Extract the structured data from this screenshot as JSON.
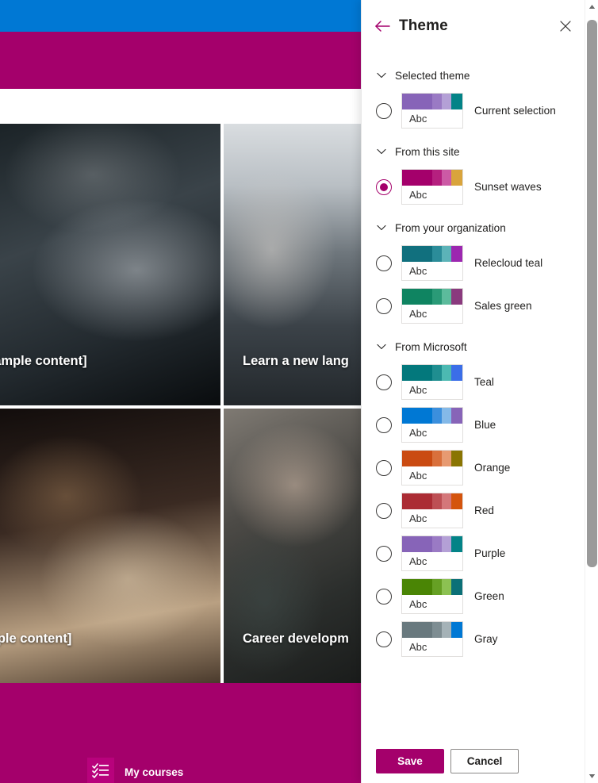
{
  "background": {
    "nav_bar_color": "#0078d4",
    "hero_band_color": "#a4006b",
    "footer_color": "#a4006b",
    "cards": [
      {
        "title": "s [Sample content]",
        "image": "handshake-photo"
      },
      {
        "title": "Learn a new lang",
        "image": "office-meeting-photo"
      },
      {
        "title": "Sample content]",
        "image": "woman-at-desk-photo"
      },
      {
        "title": "Career developm",
        "image": "hands-together-photo"
      }
    ],
    "footer": {
      "icon": "checklist-icon",
      "label": "My courses"
    }
  },
  "panel": {
    "back_icon": "back-arrow-icon",
    "title": "Theme",
    "close_icon": "close-icon",
    "sections": [
      {
        "id": "selected-theme",
        "label": "Selected theme",
        "chevron": "chevron-down-icon",
        "options": [
          {
            "label": "Current selection",
            "selected": false,
            "sample_text": "Abc",
            "colors": [
              "#8764b8",
              "#9a7ac4",
              "#b4a0d6",
              "#038387"
            ]
          }
        ]
      },
      {
        "id": "from-this-site",
        "label": "From this site",
        "chevron": "chevron-down-icon",
        "options": [
          {
            "label": "Sunset waves",
            "selected": true,
            "sample_text": "Abc",
            "colors": [
              "#a4006b",
              "#b5207f",
              "#cc5aa5",
              "#d9a43c"
            ]
          }
        ]
      },
      {
        "id": "from-your-organization",
        "label": "From your organization",
        "chevron": "chevron-down-icon",
        "options": [
          {
            "label": "Relecloud teal",
            "selected": false,
            "sample_text": "Abc",
            "colors": [
              "#11707e",
              "#2b8c99",
              "#5cb3b8",
              "#9c27b0"
            ]
          },
          {
            "label": "Sales green",
            "selected": false,
            "sample_text": "Abc",
            "colors": [
              "#0f8461",
              "#2a9a77",
              "#5cbb9c",
              "#8a3a7e"
            ]
          }
        ]
      },
      {
        "id": "from-microsoft",
        "label": "From Microsoft",
        "chevron": "chevron-down-icon",
        "options": [
          {
            "label": "Teal",
            "selected": false,
            "sample_text": "Abc",
            "colors": [
              "#03787c",
              "#1f8e90",
              "#4cb9b2",
              "#3b6ee8"
            ]
          },
          {
            "label": "Blue",
            "selected": false,
            "sample_text": "Abc",
            "colors": [
              "#0078d4",
              "#3b8fdd",
              "#84b9e8",
              "#8764b8"
            ]
          },
          {
            "label": "Orange",
            "selected": false,
            "sample_text": "Abc",
            "colors": [
              "#ca4b12",
              "#d9703c",
              "#e79a71",
              "#8a7503"
            ]
          },
          {
            "label": "Red",
            "selected": false,
            "sample_text": "Abc",
            "colors": [
              "#ab2c34",
              "#bd4f54",
              "#d4777a",
              "#d4540d"
            ]
          },
          {
            "label": "Purple",
            "selected": false,
            "sample_text": "Abc",
            "colors": [
              "#8764b8",
              "#9a7ac4",
              "#b4a0d6",
              "#038387"
            ]
          },
          {
            "label": "Green",
            "selected": false,
            "sample_text": "Abc",
            "colors": [
              "#4a8505",
              "#66a024",
              "#8cc152",
              "#0b7077"
            ]
          },
          {
            "label": "Gray",
            "selected": false,
            "sample_text": "Abc",
            "colors": [
              "#69797e",
              "#7e8d92",
              "#a5b2b7",
              "#0078d4"
            ]
          }
        ]
      }
    ],
    "footer": {
      "save_label": "Save",
      "cancel_label": "Cancel",
      "save_color": "#a4006b"
    }
  },
  "scrollbar": {
    "up_icon": "scroll-up-arrow-icon",
    "down_icon": "scroll-down-arrow-icon",
    "thumb": "scroll-thumb"
  }
}
